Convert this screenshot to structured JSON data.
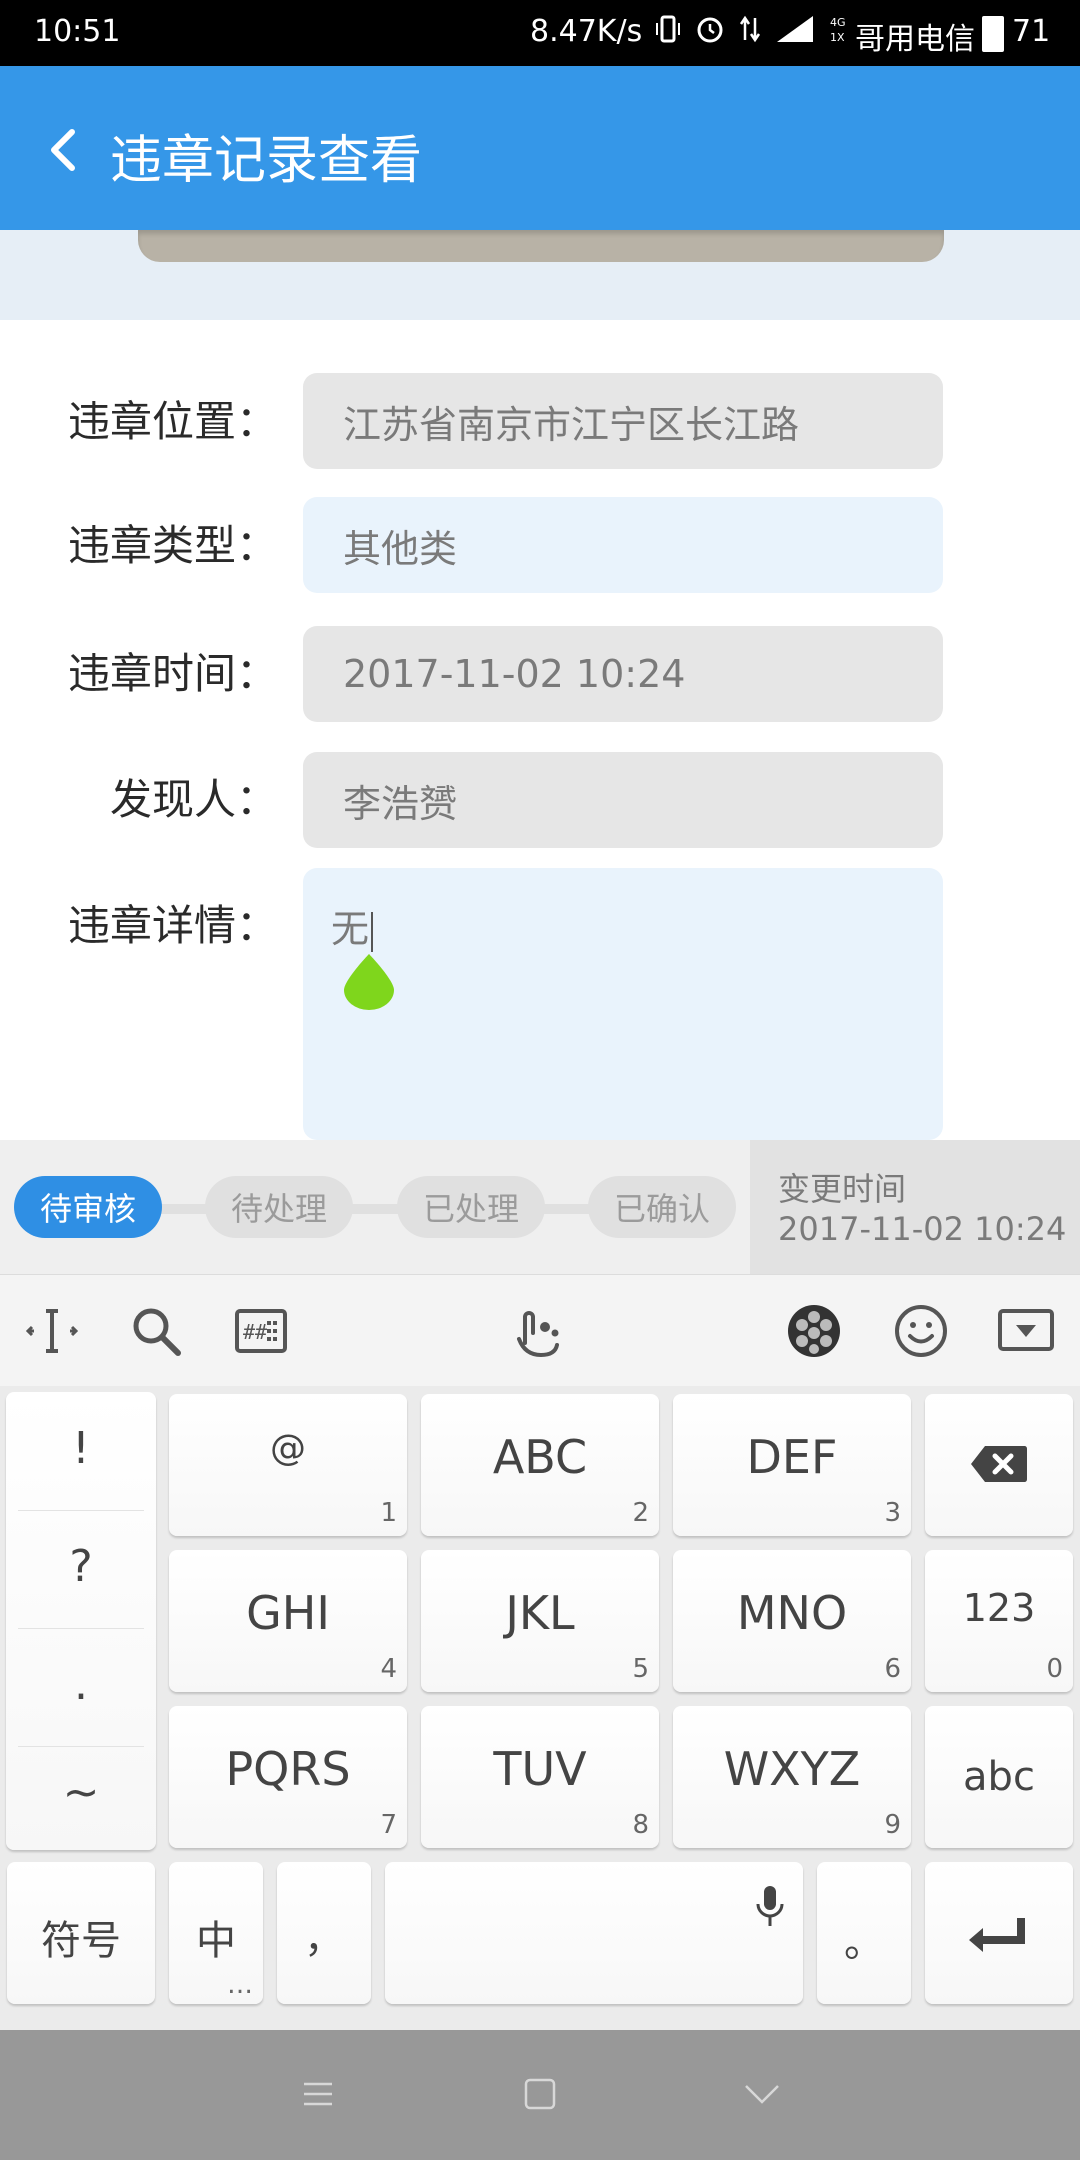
{
  "status_bar": {
    "time": "10:51",
    "speed": "8.47K/s",
    "carrier": "哥用电信",
    "battery": "71"
  },
  "header": {
    "title": "违章记录查看",
    "back_icon": "chevron-left-icon"
  },
  "form": {
    "location_label": "违章位置：",
    "location_value": "江苏省南京市江宁区长江路",
    "type_label": "违章类型：",
    "type_value": "其他类",
    "time_label": "违章时间：",
    "time_value": "2017-11-02 10:24",
    "finder_label": "发现人：",
    "finder_value": "李浩赟",
    "detail_label": "违章详情：",
    "detail_value": "无"
  },
  "progress": {
    "steps": [
      "待审核",
      "待处理",
      "已处理",
      "已确认"
    ],
    "active_index": 0,
    "change_time_label": "变更时间",
    "change_time_value": "2017-11-02 10:24"
  },
  "keyboard": {
    "toolbar_icons": [
      "cursor-icon",
      "search-icon",
      "keypad-icon",
      "handwriting-icon",
      "theme-icon",
      "emoji-icon",
      "hide-keyboard-icon"
    ],
    "punctuation": [
      "!",
      "?",
      ".",
      "~"
    ],
    "keys": [
      {
        "main": "@",
        "sub": "1"
      },
      {
        "main": "ABC",
        "sub": "2"
      },
      {
        "main": "DEF",
        "sub": "3"
      },
      {
        "main": "GHI",
        "sub": "4"
      },
      {
        "main": "JKL",
        "sub": "5"
      },
      {
        "main": "MNO",
        "sub": "6"
      },
      {
        "main": "PQRS",
        "sub": "7"
      },
      {
        "main": "TUV",
        "sub": "8"
      },
      {
        "main": "WXYZ",
        "sub": "9"
      }
    ],
    "key_123": {
      "main": "123",
      "sub": "0"
    },
    "key_abc": "abc",
    "key_symbols": "符号",
    "key_chinese": "中",
    "key_chinese_sub": "…",
    "key_comma": "，",
    "key_period": "。"
  },
  "colors": {
    "header": "#3597e8",
    "active_step": "#2f8fe4",
    "handle": "#7fd61c"
  }
}
